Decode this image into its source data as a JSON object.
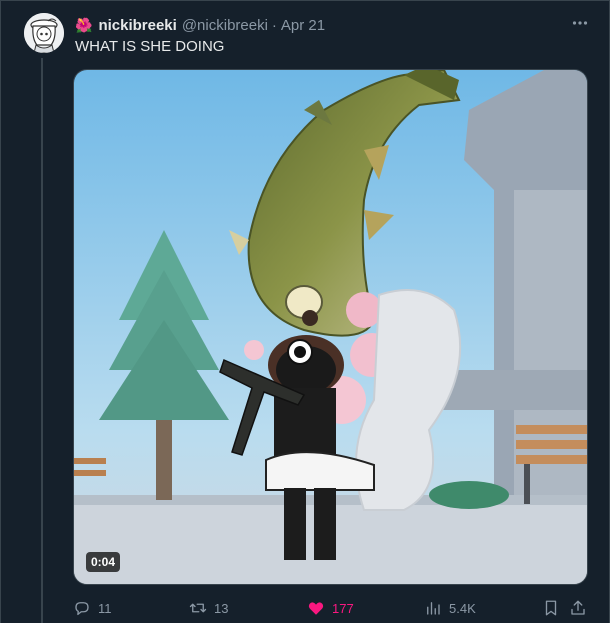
{
  "tweet": {
    "author_display_name": "nickibreeki",
    "author_handle": "@nickibreeki",
    "separator": "·",
    "date": "Apr 21",
    "flower_emoji": "🌺",
    "text": "WHAT IS SHE DOING",
    "more_icon": "more-horizontal-icon"
  },
  "media": {
    "type": "video",
    "duration": "0:04"
  },
  "actions": {
    "replies": "11",
    "retweets": "13",
    "likes": "177",
    "views": "5.4K",
    "like_color": "#f91880",
    "liked": true
  },
  "colors": {
    "background": "#15202b",
    "text_primary": "#e7e9ea",
    "text_secondary": "#8b98a5",
    "border": "#38444d"
  }
}
